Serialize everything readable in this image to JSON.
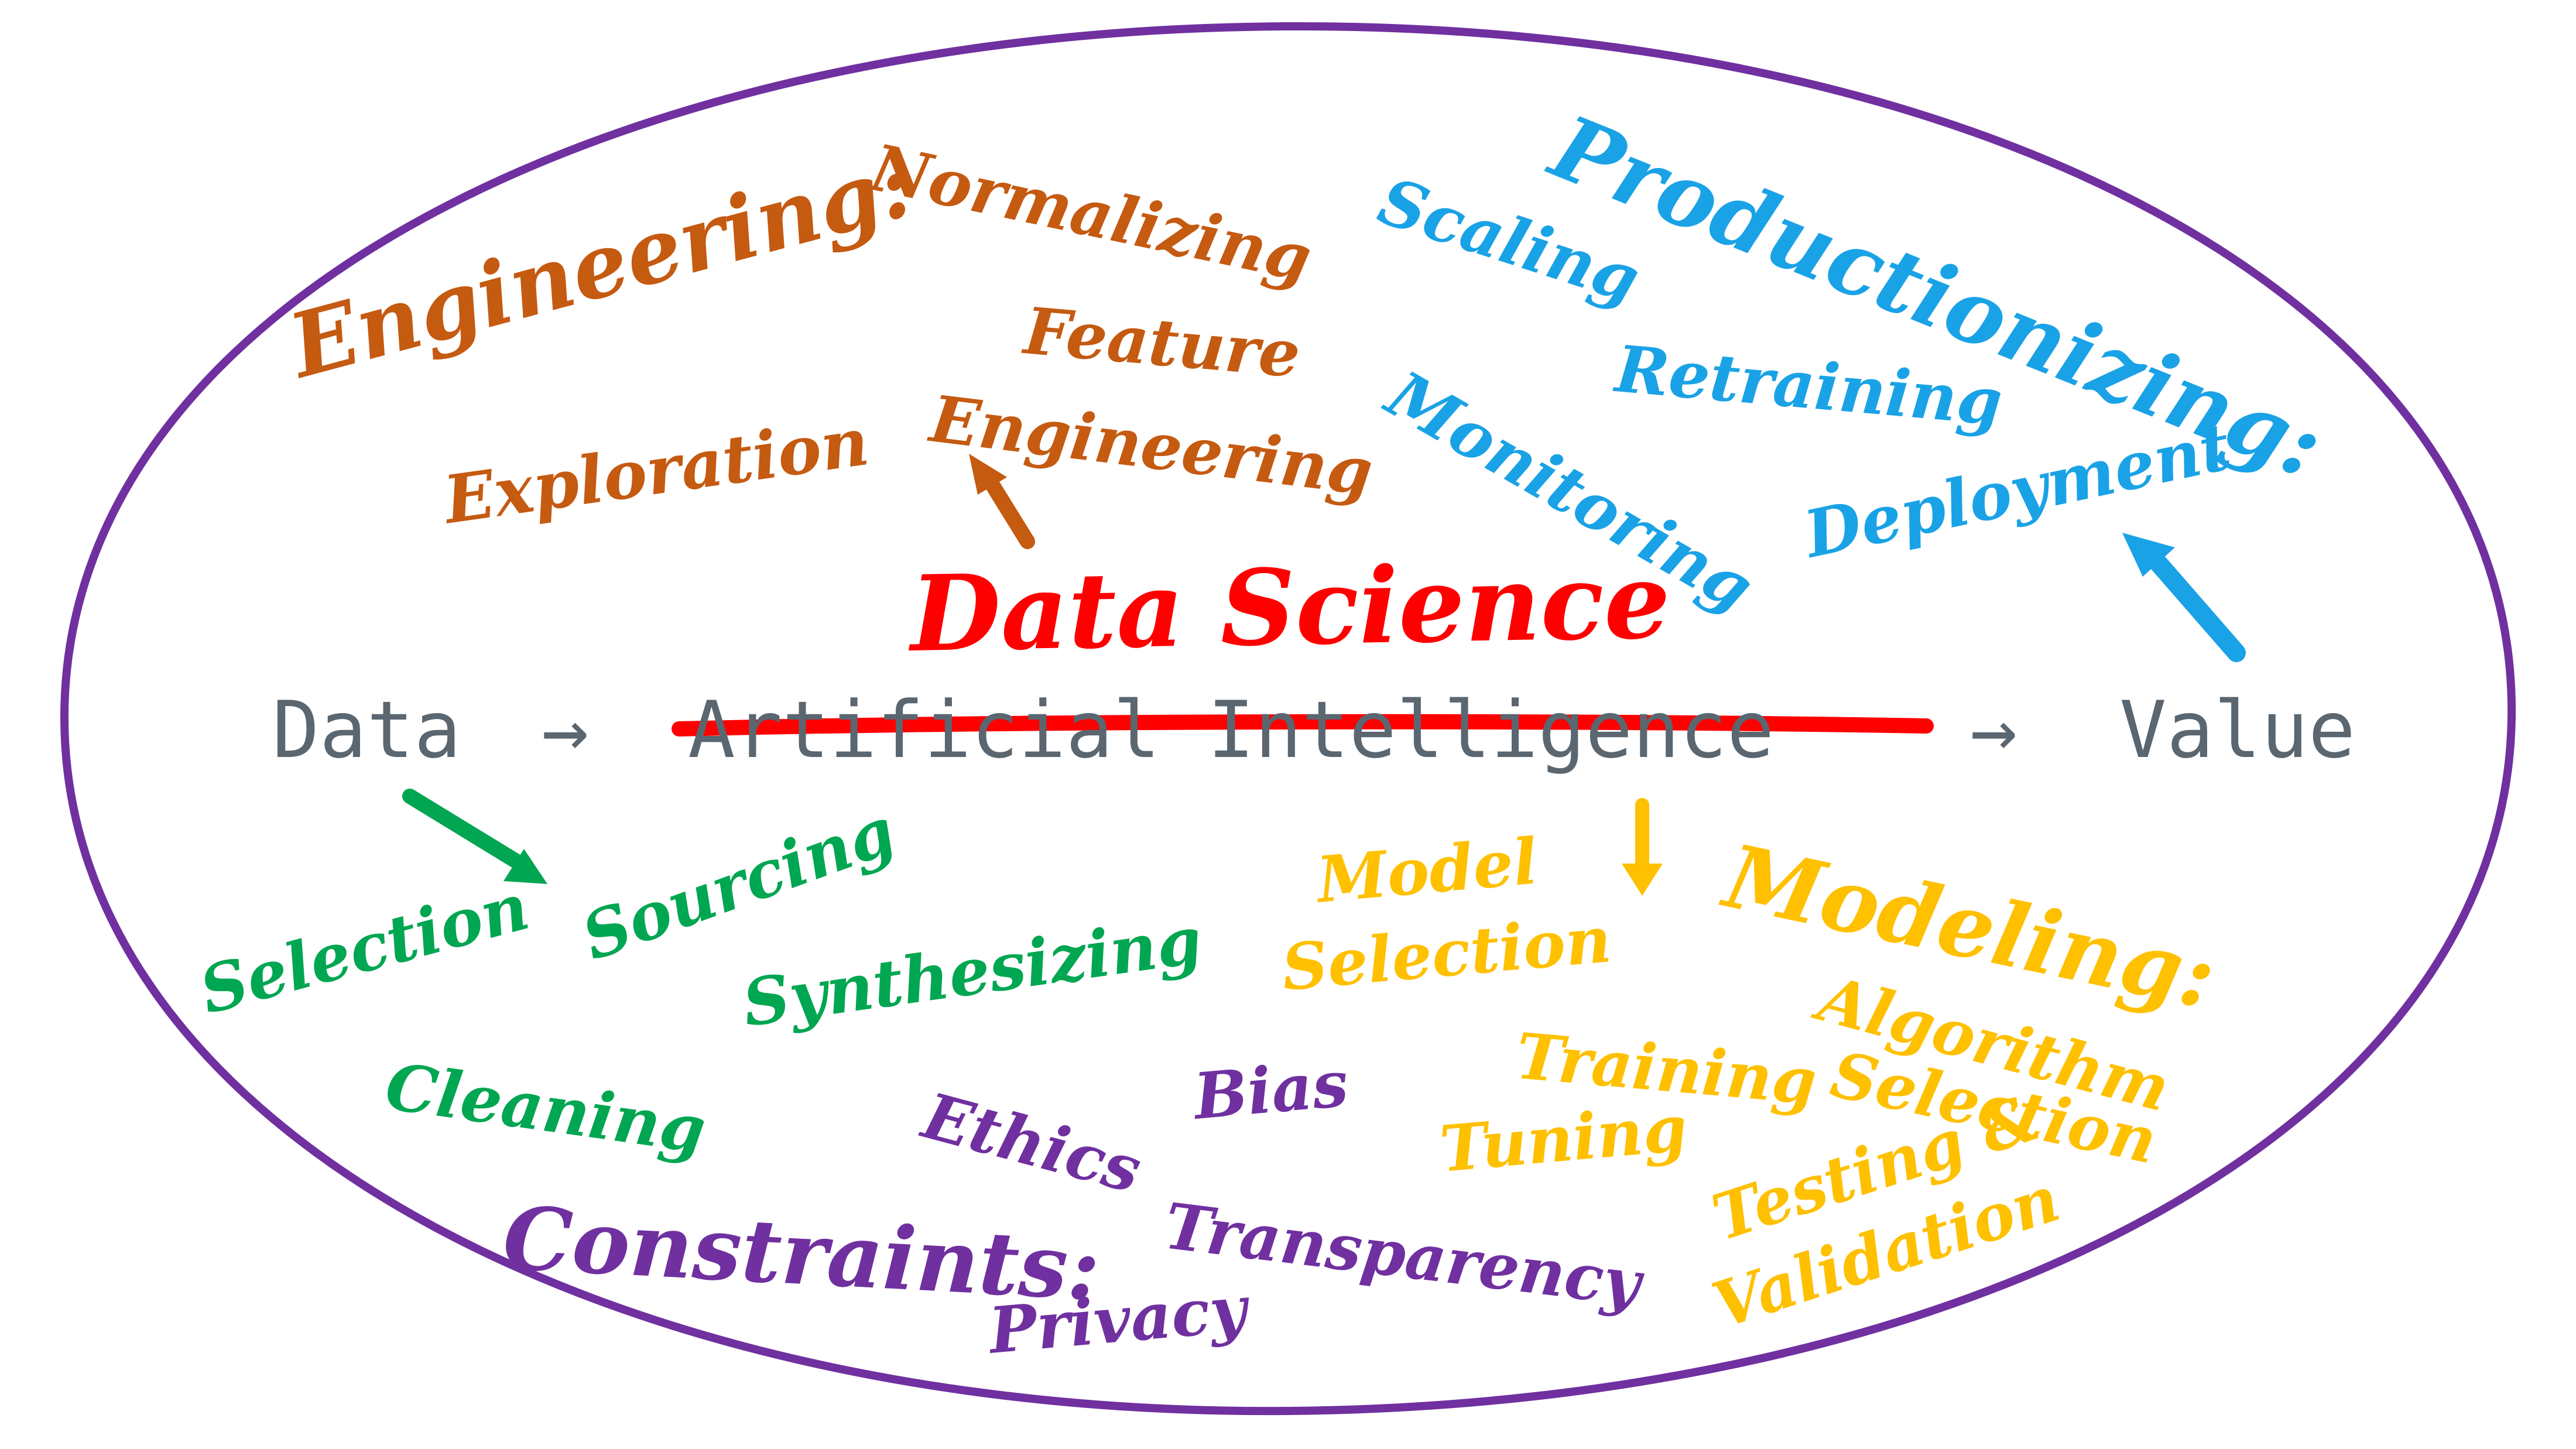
{
  "colors": {
    "ellipse": "#7030a0",
    "engineering": "#c55a11",
    "productionizing": "#1aa2e6",
    "data": "#00a651",
    "modeling": "#ffc000",
    "constraints": "#7030a0",
    "strike": "#ff0000",
    "pipeline": "#5a6670"
  },
  "pipeline": {
    "data": "Data",
    "arrow_1": "→",
    "ai": "Artificial Intelligence",
    "arrow_2": "→",
    "value": "Value"
  },
  "center": {
    "title": "Data Science"
  },
  "engineering": {
    "heading": "Engineering:",
    "normalizing": "Normalizing",
    "feature_1": "Feature",
    "feature_2": "Engineering",
    "exploration": "Exploration"
  },
  "productionizing": {
    "heading": "Productionizing:",
    "scaling": "Scaling",
    "retraining": "Retraining",
    "monitoring": "Monitoring",
    "deployment": "Deployment"
  },
  "data_group": {
    "selection": "Selection",
    "sourcing": "Sourcing",
    "synthesizing": "Synthesizing",
    "cleaning": "Cleaning"
  },
  "modeling": {
    "heading": "Modeling:",
    "model_1": "Model",
    "model_2": "Selection",
    "training": "Training",
    "algorithm_1": "Algorithm",
    "algorithm_2": "Selection",
    "tuning": "Tuning",
    "testing_1": "Testing &",
    "testing_2": "Validation"
  },
  "constraints": {
    "heading": "Constraints:",
    "ethics": "Ethics",
    "bias": "Bias",
    "transparency": "Transparency",
    "privacy": "Privacy"
  }
}
